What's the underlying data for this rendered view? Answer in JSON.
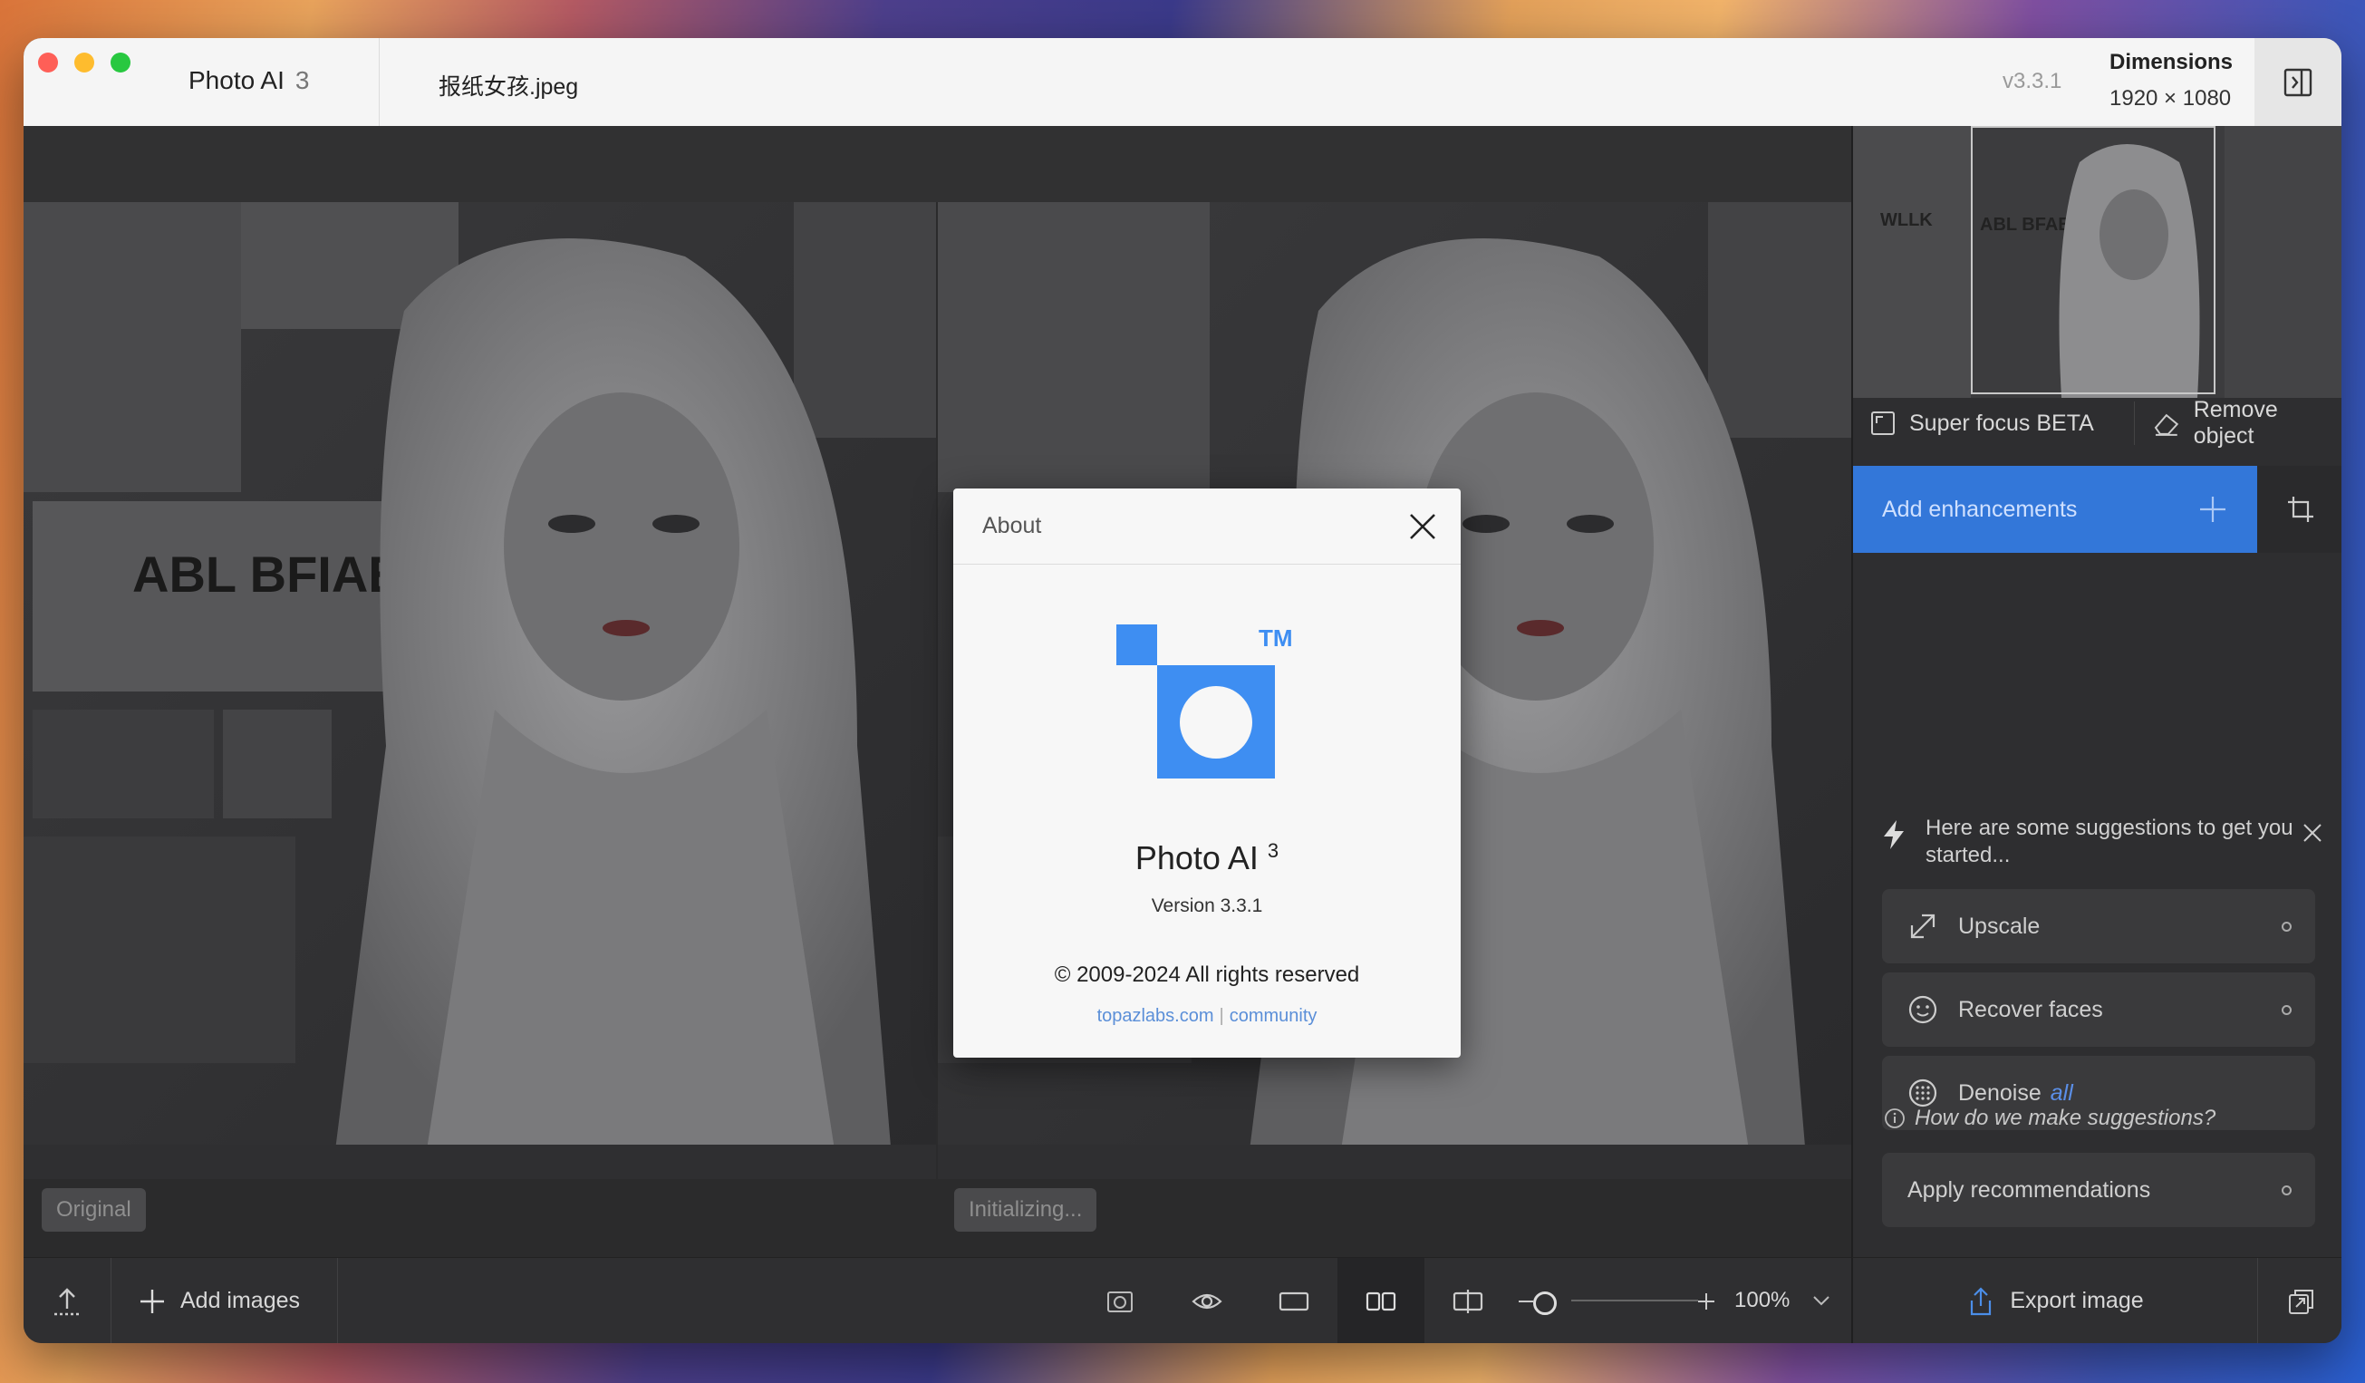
{
  "titlebar": {
    "app_name": "Photo AI",
    "app_version_badge": "3",
    "file_name": "报纸女孩.jpeg",
    "version": "v3.3.1",
    "dimensions_label": "Dimensions",
    "dimensions_value": "1920 × 1080"
  },
  "canvas": {
    "left_label": "Original",
    "right_label": "Initializing..."
  },
  "sidebar": {
    "super_focus": "Super focus BETA",
    "remove_object": "Remove object",
    "add_enhancements": "Add enhancements",
    "suggestions_header": "Here are some suggestions to get you started...",
    "suggestions": [
      {
        "label": "Upscale",
        "icon": "expand-arrow-icon"
      },
      {
        "label": "Recover faces",
        "icon": "face-icon"
      },
      {
        "label": "Denoise",
        "icon": "denoise-icon",
        "tag": "all"
      }
    ],
    "how_we_suggest": "How do we make suggestions?",
    "apply_recommendations": "Apply recommendations"
  },
  "bottombar": {
    "add_images": "Add images",
    "zoom": "100%"
  },
  "export": {
    "label": "Export image"
  },
  "about_dialog": {
    "title": "About",
    "tm": "TM",
    "product_name": "Photo AI",
    "product_sup": "3",
    "version": "Version 3.3.1",
    "copyright": "© 2009-2024 All rights reserved",
    "link_site": "topazlabs.com",
    "link_separator": "|",
    "link_community": "community"
  },
  "colors": {
    "accent": "#3377d9",
    "logo_blue": "#3e8ef2",
    "link_blue": "#5b8fd8"
  }
}
